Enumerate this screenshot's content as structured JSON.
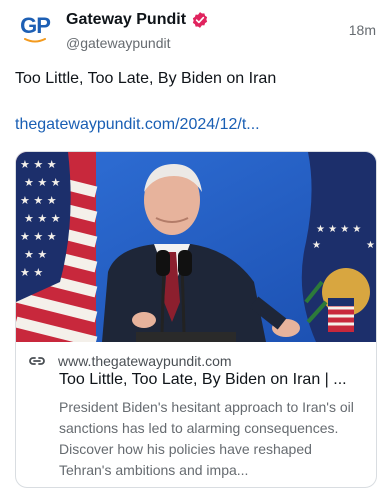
{
  "author": {
    "display_name": "Gateway Pundit",
    "handle": "@gatewaypundit",
    "avatar_text": "GP",
    "verified": true
  },
  "post": {
    "timestamp": "18m",
    "text": "Too Little, Too Late, By Biden on Iran",
    "link_text": "thegatewaypundit.com/2024/12/t..."
  },
  "card": {
    "domain": "www.thegatewaypundit.com",
    "title": "Too Little, Too Late, By Biden on Iran | ...",
    "description": "President Biden's hesitant approach to Iran's oil sanctions has led to alarming consequences. Discover how his policies have reshaped Tehran's ambitions and impa..."
  },
  "colors": {
    "link": "#1a5fb4",
    "verified_badge": "#e0245e",
    "avatar_brand": "#1d5fb4",
    "swoosh": "#f39a1e"
  }
}
